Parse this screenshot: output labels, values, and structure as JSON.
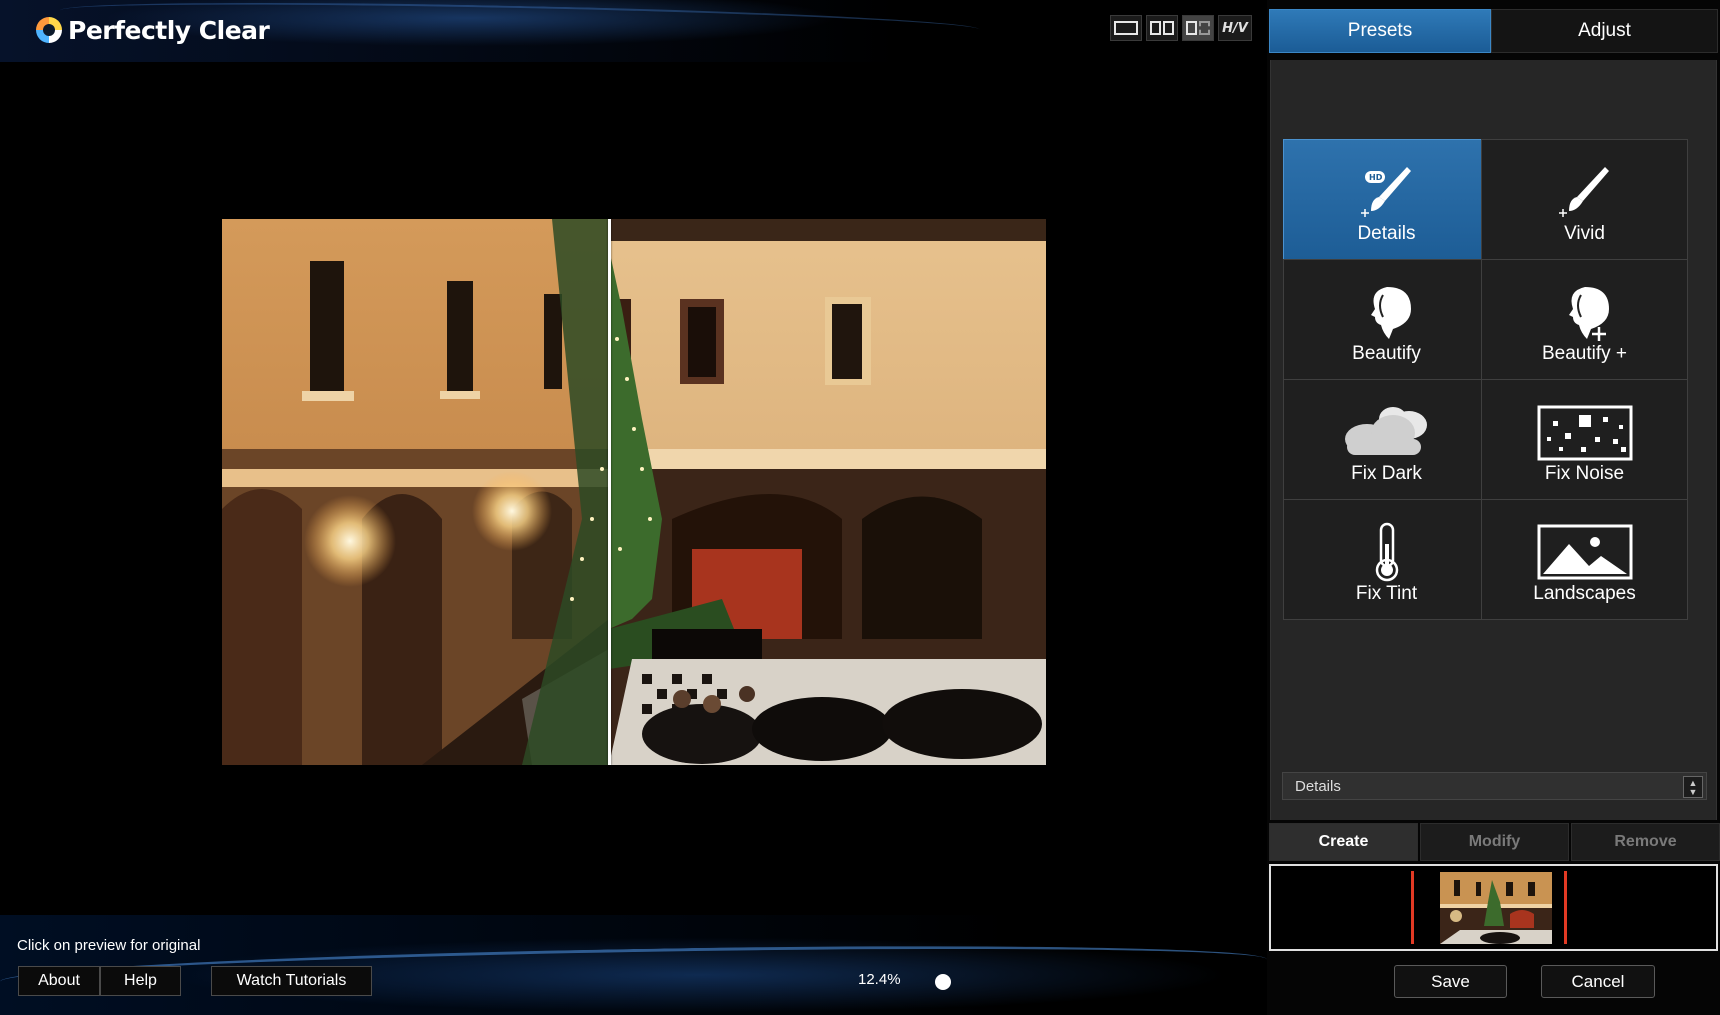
{
  "app": {
    "title": "Perfectly Clear"
  },
  "view_modes": [
    {
      "name": "single-view"
    },
    {
      "name": "side-by-side"
    },
    {
      "name": "split-view"
    },
    {
      "name": "hv-toggle",
      "label": "H/V"
    }
  ],
  "preview": {
    "hint": "Click on preview for original"
  },
  "bottom_bar": {
    "about_label": "About",
    "help_label": "Help",
    "tutorials_label": "Watch Tutorials",
    "zoom": "12.4%"
  },
  "panel": {
    "tabs": [
      {
        "label": "Presets",
        "active": true
      },
      {
        "label": "Adjust",
        "active": false
      }
    ],
    "presets": [
      {
        "label": "Details",
        "icon": "brush-hd-icon",
        "selected": true
      },
      {
        "label": "Vivid",
        "icon": "brush-icon",
        "selected": false
      },
      {
        "label": "Beautify",
        "icon": "face-profile-icon",
        "selected": false
      },
      {
        "label": "Beautify +",
        "icon": "face-profile-plus-icon",
        "selected": false
      },
      {
        "label": "Fix Dark",
        "icon": "cloud-icon",
        "selected": false
      },
      {
        "label": "Fix Noise",
        "icon": "noise-icon",
        "selected": false
      },
      {
        "label": "Fix Tint",
        "icon": "thermometer-icon",
        "selected": false
      },
      {
        "label": "Landscapes",
        "icon": "landscape-icon",
        "selected": false
      }
    ],
    "preset_select": {
      "value": "Details"
    },
    "preset_actions": [
      {
        "label": "Create",
        "enabled": true
      },
      {
        "label": "Modify",
        "enabled": false
      },
      {
        "label": "Remove",
        "enabled": false
      }
    ],
    "save_label": "Save",
    "cancel_label": "Cancel"
  },
  "colors": {
    "accent_blue": "#2a6fae",
    "marker_red": "#e23a24",
    "panel_bg": "#262626"
  }
}
